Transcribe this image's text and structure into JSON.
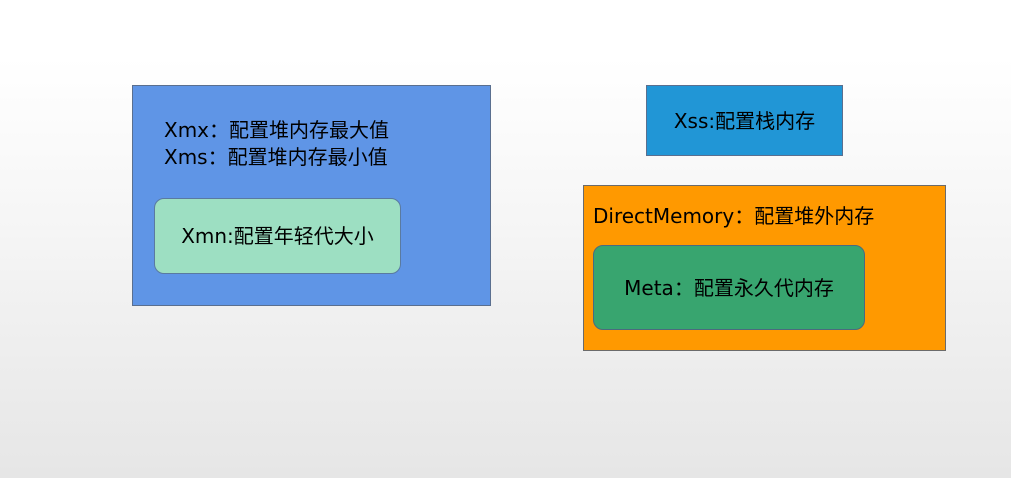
{
  "heap": {
    "xmx_label": "Xmx：配置堆内存最大值",
    "xms_label": "Xms：配置堆内存最小值",
    "young": {
      "label": "Xmn:配置年轻代大小"
    }
  },
  "stack": {
    "label": "Xss:配置栈内存"
  },
  "direct_memory": {
    "label": "DirectMemory：配置堆外内存",
    "meta": {
      "label": "Meta：配置永久代内存"
    }
  },
  "colors": {
    "heap": "#5f95e6",
    "young": "#9ddfc2",
    "stack": "#2196d6",
    "direct_memory": "#ff9900",
    "meta": "#38a56f"
  }
}
